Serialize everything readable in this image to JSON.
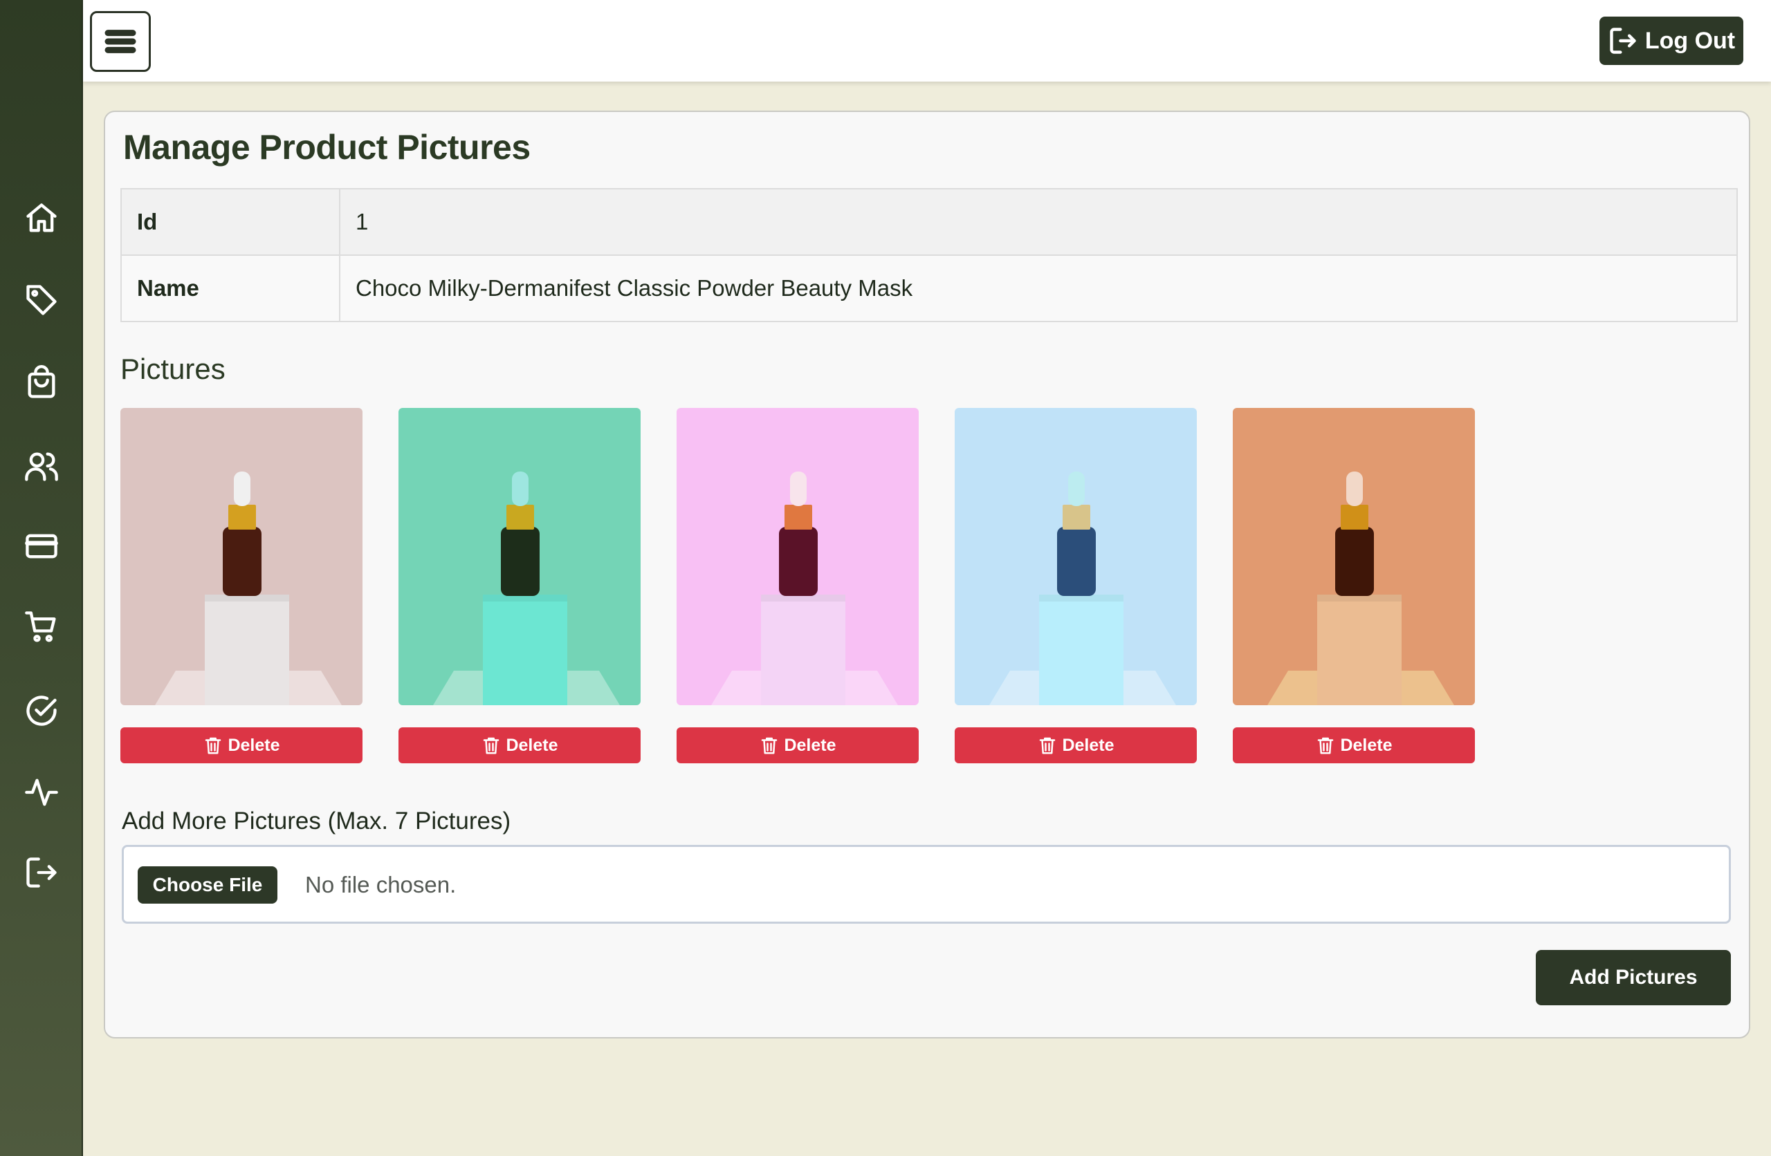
{
  "header": {
    "logout_label": "Log Out"
  },
  "sidebar": {
    "items": [
      {
        "icon": "home-icon"
      },
      {
        "icon": "tag-icon"
      },
      {
        "icon": "shopping-bag-icon"
      },
      {
        "icon": "users-icon"
      },
      {
        "icon": "credit-card-icon"
      },
      {
        "icon": "cart-icon"
      },
      {
        "icon": "check-circle-icon"
      },
      {
        "icon": "activity-icon"
      },
      {
        "icon": "logout-icon"
      }
    ]
  },
  "page": {
    "title": "Manage Product Pictures",
    "table": [
      {
        "key": "Id",
        "value": "1"
      },
      {
        "key": "Name",
        "value": "Choco Milky-Dermanifest Classic Powder Beauty Mask"
      }
    ],
    "pictures_heading": "Pictures",
    "pictures": [
      {
        "delete_label": "Delete",
        "bg": "#dcc4c1",
        "cap": "#f0f0f0",
        "bottle": "#4a1c10",
        "block": "#e8e4e4"
      },
      {
        "delete_label": "Delete",
        "bg": "#74d4b6",
        "cap": "#9ee6e0",
        "bottle": "#1d2d1a",
        "block": "#6ce6d2"
      },
      {
        "delete_label": "Delete",
        "bg": "#f8c0f4",
        "cap": "#f8e4ec",
        "bottle": "#5a1228",
        "block": "#f4d4f6"
      },
      {
        "delete_label": "Delete",
        "bg": "#c0e2f8",
        "cap": "#bcecf0",
        "bottle": "#2b4e7a",
        "block": "#b8eefc"
      },
      {
        "delete_label": "Delete",
        "bg": "#e19a70",
        "cap": "#f2d8c8",
        "bottle": "#3f1608",
        "block": "#ebbc92"
      }
    ],
    "add_more_label": "Add More Pictures (Max. 7 Pictures)",
    "choose_file_label": "Choose File",
    "file_status": "No file chosen.",
    "add_pictures_label": "Add Pictures"
  },
  "colors": {
    "sidebar": "#3d4a30",
    "primary_button": "#2d3827",
    "danger": "#dc3545",
    "page_bg": "#efeddb"
  }
}
